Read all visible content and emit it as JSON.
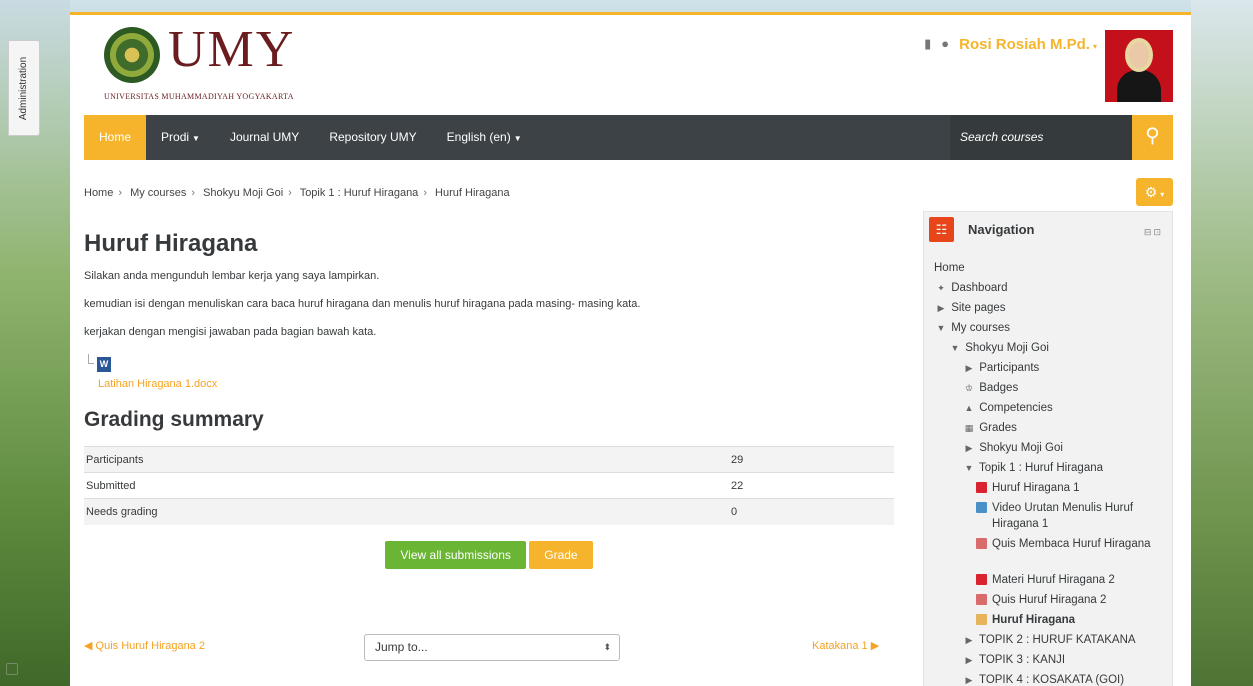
{
  "sidebar_tab": {
    "label": "Administration"
  },
  "header": {
    "logo_text": "UMY",
    "logo_subtitle": "UNIVERSITAS MUHAMMADIYAH YOGYAKARTA",
    "user_name": "Rosi Rosiah M.Pd.",
    "message_icon": "message-icon",
    "notification_icon": "bell-icon"
  },
  "navbar": {
    "items": [
      {
        "label": "Home",
        "active": true
      },
      {
        "label": "Prodi",
        "dropdown": true
      },
      {
        "label": "Journal UMY"
      },
      {
        "label": "Repository UMY"
      },
      {
        "label": "English (en)",
        "dropdown": true
      }
    ],
    "search_placeholder": "Search courses",
    "accent_color": "#f6b42c",
    "nav_color": "#3d4246"
  },
  "breadcrumb": [
    "Home",
    "My courses",
    "Shokyu Moji Goi",
    "Topik 1 : Huruf Hiragana",
    "Huruf Hiragana"
  ],
  "main": {
    "title": "Huruf Hiragana",
    "paragraphs": [
      "Silakan anda mengunduh lembar kerja yang saya lampirkan.",
      "kemudian isi dengan menuliskan cara baca huruf hiragana dan menulis huruf hiragana pada masing- masing kata.",
      "kerjakan dengan mengisi jawaban pada bagian bawah kata."
    ],
    "attachment": "Latihan Hiragana 1.docx",
    "grading_title": "Grading summary",
    "grading_rows": [
      {
        "label": "Participants",
        "value": "29"
      },
      {
        "label": "Submitted",
        "value": "22"
      },
      {
        "label": "Needs grading",
        "value": "0"
      }
    ],
    "view_all_label": "View all submissions",
    "grade_label": "Grade",
    "prev_link": "Quis Huruf Hiragana 2",
    "next_link": "Katakana 1",
    "jump_label": "Jump to..."
  },
  "navigation": {
    "title": "Navigation",
    "items": [
      {
        "label": "Home"
      },
      {
        "label": "Dashboard"
      },
      {
        "label": "Site pages"
      },
      {
        "label": "My courses"
      },
      {
        "label": "Shokyu Moji Goi"
      },
      {
        "label": "Participants"
      },
      {
        "label": "Badges"
      },
      {
        "label": "Competencies"
      },
      {
        "label": "Grades"
      },
      {
        "label": "Shokyu Moji Goi"
      },
      {
        "label": "Topik 1 : Huruf Hiragana"
      },
      {
        "label": "Huruf Hiragana 1"
      },
      {
        "label": "Video Urutan Menulis Huruf Hiragana 1"
      },
      {
        "label": "Quis Membaca Huruf Hiragana"
      },
      {
        "label": "Materi Huruf Hiragana 2"
      },
      {
        "label": "Quis Huruf Hiragana 2"
      },
      {
        "label": "Huruf Hiragana"
      },
      {
        "label": "TOPIK 2 : HURUF KATAKANA"
      },
      {
        "label": "TOPIK 3 : KANJI"
      },
      {
        "label": "TOPIK 4 : KOSAKATA (GOI)"
      }
    ]
  }
}
